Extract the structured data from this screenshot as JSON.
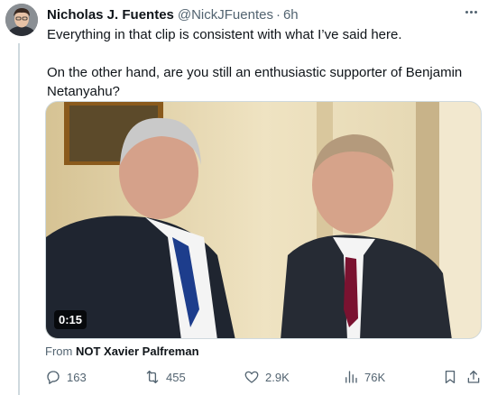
{
  "tweet": {
    "author_name": "Nicholas J. Fuentes",
    "author_handle": "@NickJFuentes",
    "separator": "·",
    "time": "6h",
    "line1": "Everything in that clip is consistent with what I’ve said here.",
    "line2": "On the other hand, are you still an enthusiastic supporter of Benjamin Netanyahu?"
  },
  "media": {
    "duration": "0:15",
    "from_label": "From",
    "from_source": "NOT Xavier Palfreman"
  },
  "actions": {
    "replies": "163",
    "reposts": "455",
    "likes": "2.9K",
    "views": "76K"
  },
  "icons": {
    "reply": "reply-icon",
    "repost": "repost-icon",
    "like": "like-icon",
    "views": "views-icon",
    "bookmark": "bookmark-icon",
    "share": "share-icon",
    "more": "more-icon"
  },
  "colors": {
    "text": "#0f1419",
    "secondary": "#536471",
    "border": "#cfd9de"
  }
}
